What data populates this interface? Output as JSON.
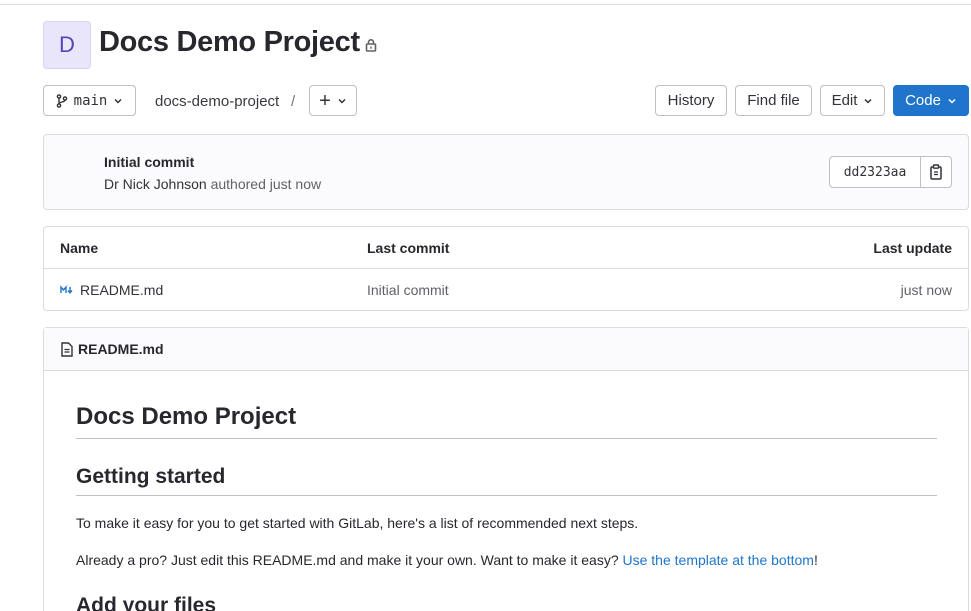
{
  "project": {
    "avatar_letter": "D",
    "title": "Docs Demo Project",
    "visibility_icon": "lock-icon"
  },
  "toolbar": {
    "branch_icon": "branch-icon",
    "branch": "main",
    "path": "docs-demo-project",
    "path_separator": "/",
    "add_label": "+",
    "history_label": "History",
    "find_file_label": "Find file",
    "edit_label": "Edit",
    "code_label": "Code"
  },
  "last_commit": {
    "title": "Initial commit",
    "author": "Dr Nick Johnson",
    "authored_text": "authored just now",
    "sha": "dd2323aa"
  },
  "file_table": {
    "headers": [
      "Name",
      "Last commit",
      "Last update"
    ],
    "rows": [
      {
        "icon": "markdown-icon",
        "name": "README.md",
        "last_commit": "Initial commit",
        "last_update": "just now"
      }
    ]
  },
  "readme": {
    "file_name": "README.md",
    "h1": "Docs Demo Project",
    "h2_getting_started": "Getting started",
    "p1": "To make it easy for you to get started with GitLab, here's a list of recommended next steps.",
    "p2_prefix": "Already a pro? Just edit this README.md and make it your own. Want to make it easy? ",
    "p2_link": "Use the template at the bottom",
    "p2_suffix": "!",
    "h2_add_files": "Add your files"
  },
  "colors": {
    "primary": "#1f75cb",
    "avatar_bg": "#e9e6fb",
    "avatar_text": "#5943b6"
  }
}
